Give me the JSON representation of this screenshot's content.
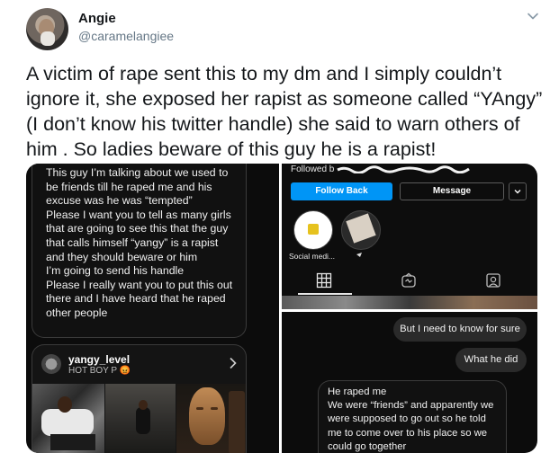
{
  "tweet": {
    "author_name": "Angie",
    "author_handle": "@caramelangiee",
    "text": "A victim of rape sent this to my dm and I simply couldn’t ignore it, she exposed her rapist as someone called “YAngy” (I don’t know his twitter handle) she said to warn others of him . So ladies beware of this guy he is a rapist!",
    "menu_icon": "chevron-down-icon"
  },
  "media": {
    "dm_message_1": [
      "This guy I’m talking about we used to be friends till he raped me and his excuse was he was “tempted”",
      "Please I want you to tell as many girls that are going to see this that the guy that calls himself “yangy” is a rapist and they should beware or him",
      "I’m going to send his handle",
      "Please I really want you to put this out there and I have heard that he raped other people"
    ],
    "ig_card": {
      "username": "yangy_level",
      "subtitle": "HOT BOY P 😡"
    },
    "profile": {
      "followed_by": "Followed b",
      "follow_back_label": "Follow Back",
      "message_label": "Message",
      "highlight_label": "Social medi..."
    },
    "dm_bubble_1": "But I need to know for sure",
    "dm_bubble_2": "What he did",
    "dm_message_2": [
      "He raped me",
      "We were “friends” and apparently we were supposed to go out so he told me to come over to his place so we could go together"
    ]
  },
  "colors": {
    "follow_button": "#0095f6",
    "handle_gray": "#657786"
  }
}
